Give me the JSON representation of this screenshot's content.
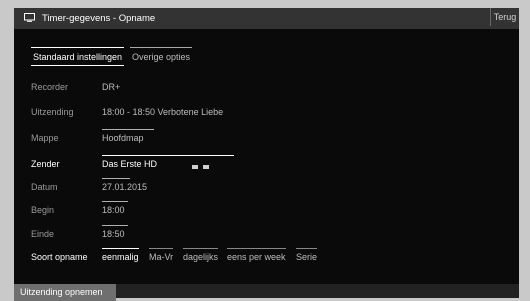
{
  "window": {
    "title": "Timer-gegevens - Opname",
    "back_label": "Terug"
  },
  "tabs": [
    {
      "label": "Standaard instellingen",
      "active": true
    },
    {
      "label": "Overige opties",
      "active": false
    }
  ],
  "fields": {
    "recorder": {
      "label": "Recorder",
      "value": "DR+"
    },
    "broadcast": {
      "label": "Uitzending",
      "value": "18:00 - 18:50 Verbotene Liebe"
    },
    "folder": {
      "label": "Mappe",
      "value": "Hoofdmap"
    },
    "channel": {
      "label": "Zender",
      "value": "Das Erste HD"
    },
    "date": {
      "label": "Datum",
      "value": "27.01.2015"
    },
    "start": {
      "label": "Begin",
      "value": "18:00"
    },
    "end": {
      "label": "Einde",
      "value": "18:50"
    }
  },
  "recording_type": {
    "label": "Soort opname",
    "options": [
      "eenmalig",
      "Ma-Vr",
      "dagelijks",
      "eens per week",
      "Serie"
    ],
    "selected": "eenmalig"
  },
  "footer": {
    "record_button": "Uitzending opnemen"
  },
  "icons": {
    "title": "monitor-icon",
    "channel_badges": [
      "hd-icon",
      "subtitle-icon"
    ]
  }
}
